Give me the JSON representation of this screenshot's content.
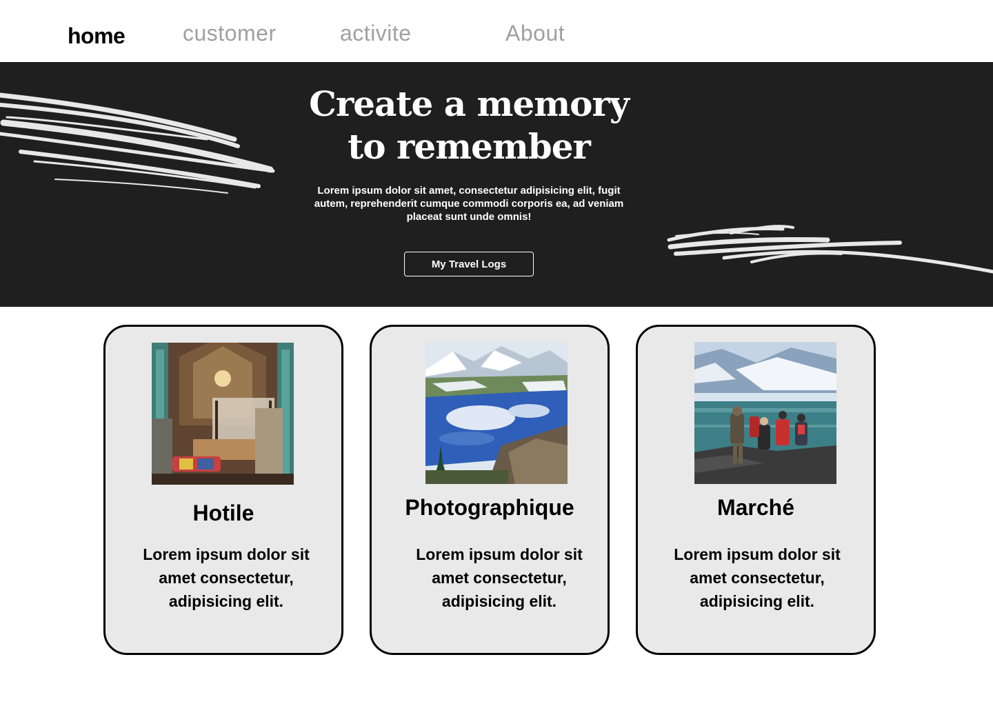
{
  "nav": {
    "items": [
      {
        "label": "home",
        "active": true
      },
      {
        "label": "customer",
        "active": false
      },
      {
        "label": "activite",
        "active": false
      },
      {
        "label": "About",
        "active": false
      }
    ]
  },
  "hero": {
    "title_line1": "Create a memory",
    "title_line2": "to remember",
    "text": "Lorem ipsum dolor sit amet, consectetur adipisicing elit, fugit autem, reprehenderit cumque commodi corporis ea, ad veniam placeat sunt unde omnis!",
    "button_label": "My Travel Logs",
    "background_color": "#1f1f1f"
  },
  "cards": [
    {
      "title": "Hotile",
      "text": "Lorem ipsum dolor sit amet consectetur, adipisicing elit.",
      "image": "hotel-room-photo"
    },
    {
      "title": "Photographique",
      "text": "Lorem ipsum dolor sit amet consectetur, adipisicing elit.",
      "image": "mountain-lake-photo"
    },
    {
      "title": "Marché",
      "text": "Lorem ipsum dolor sit amet consectetur, adipisicing elit.",
      "image": "glacier-hikers-photo"
    }
  ],
  "colors": {
    "nav_active": "#000000",
    "nav_inactive": "#a0a0a0",
    "card_background": "#e9e9e9",
    "card_border": "#000000"
  }
}
